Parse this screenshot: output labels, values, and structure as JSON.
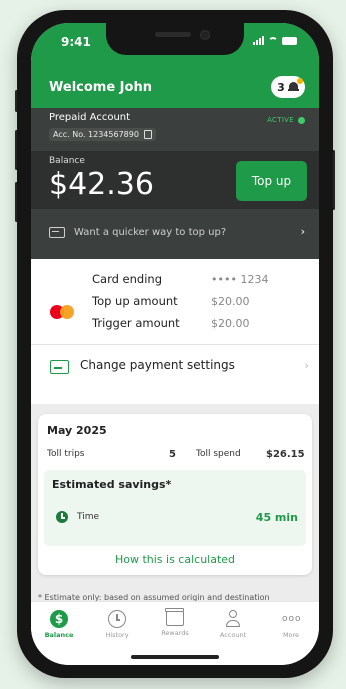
{
  "status": {
    "time": "9:41"
  },
  "header": {
    "welcome": "Welcome John",
    "notification_count": "3"
  },
  "account": {
    "type": "Prepaid Account",
    "number": "Acc. No. 1234567890",
    "status": "ACTIVE",
    "balance_label": "Balance",
    "balance": "$42.36",
    "topup_label": "Top up",
    "quicker_prompt": "Want a quicker way to top up?"
  },
  "payment": {
    "card_label": "Card ending",
    "card_value": "•••• 1234",
    "topup_amount_label": "Top up amount",
    "topup_amount_value": "$20.00",
    "trigger_label": "Trigger amount",
    "trigger_value": "$20.00",
    "change_settings": "Change payment settings"
  },
  "summary": {
    "month": "May 2025",
    "toll_trips_label": "Toll trips",
    "toll_trips_value": "5",
    "toll_spend_label": "Toll spend",
    "toll_spend_value": "$26.15",
    "savings_title": "Estimated savings*",
    "time_label": "Time",
    "time_value": "45 min",
    "how_link": "How this is calculated"
  },
  "disclaimer": "* Estimate only: based on assumed origin and destination",
  "tabs": [
    {
      "label": "Balance",
      "icon": "balance-icon"
    },
    {
      "label": "History",
      "icon": "history-icon"
    },
    {
      "label": "Rewards",
      "icon": "rewards-icon"
    },
    {
      "label": "Account",
      "icon": "account-icon"
    },
    {
      "label": "More",
      "icon": "more-icon"
    }
  ],
  "colors": {
    "brand_green": "#1f9a48",
    "dark_panel": "#3b3f3d",
    "accent_active": "#3ec96a"
  }
}
